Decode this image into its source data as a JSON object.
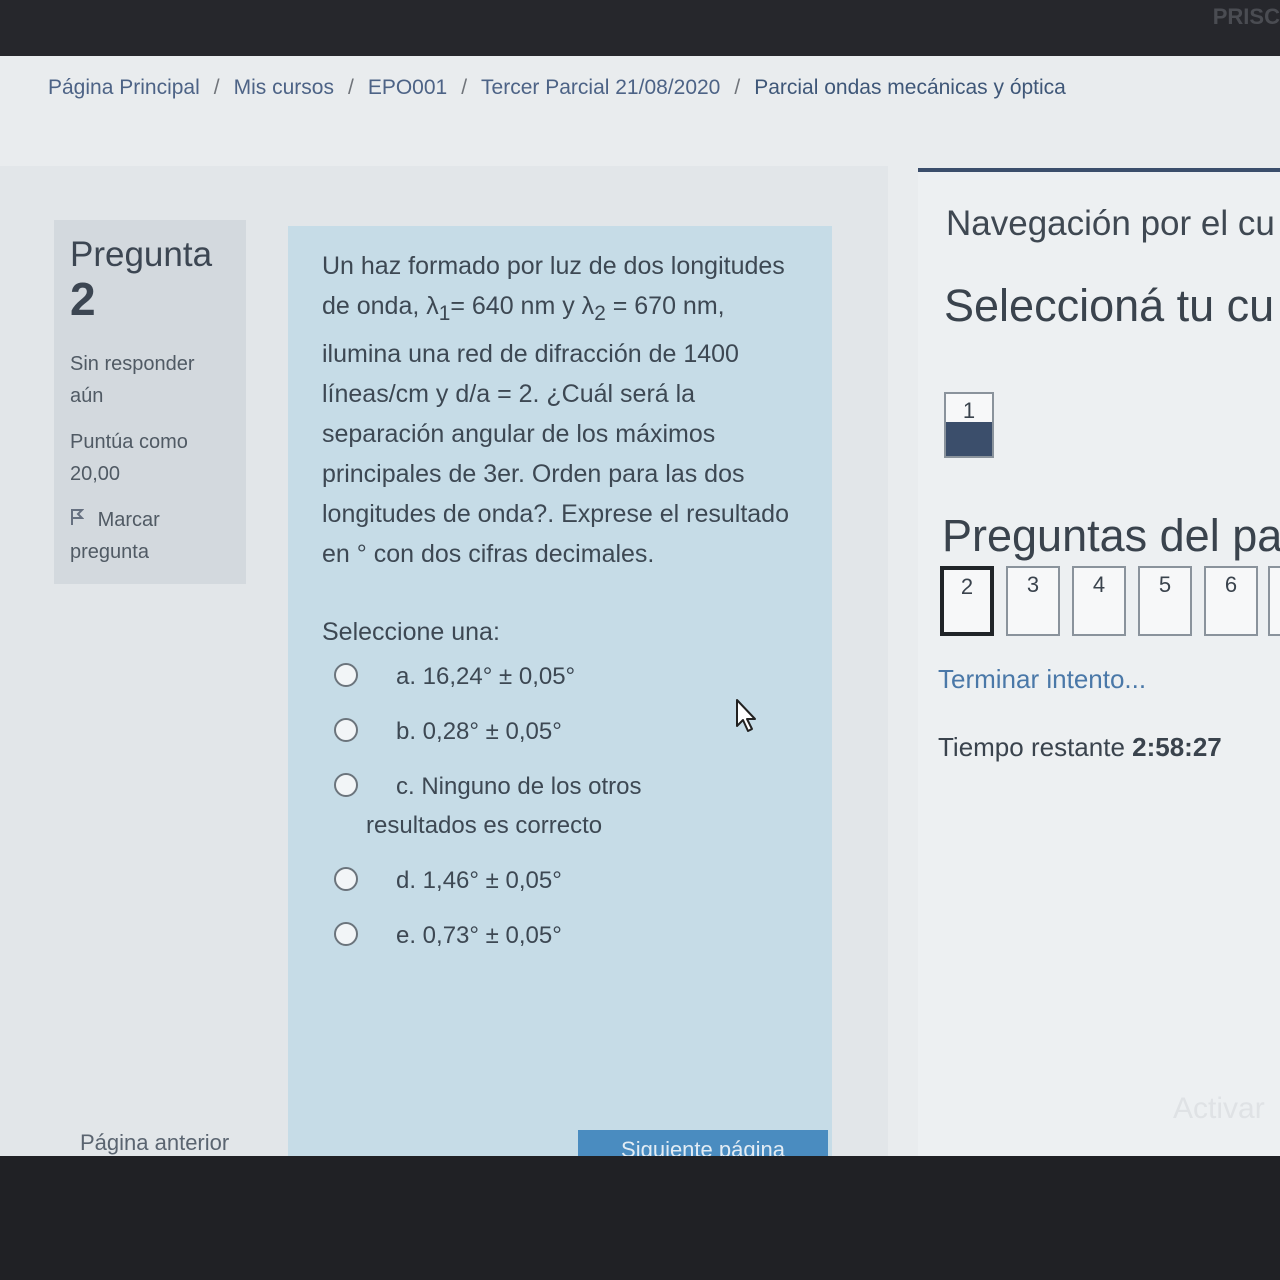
{
  "brand": "PRISC",
  "breadcrumb": [
    {
      "label": "Página Principal"
    },
    {
      "label": "Mis cursos"
    },
    {
      "label": "EPO001"
    },
    {
      "label": "Tercer Parcial 21/08/2020"
    },
    {
      "label": "Parcial ondas mecánicas y óptica"
    }
  ],
  "breadcrumb_separator": "/",
  "question": {
    "word": "Pregunta",
    "number": "2",
    "state_line1": "Sin responder",
    "state_line2": "aún",
    "grade_line1": "Puntúa como",
    "grade_line2": "20,00",
    "flag_line1": "Marcar",
    "flag_line2": "pregunta",
    "text_p1": "Un haz formado por luz de dos longitudes de onda, λ",
    "sub1": "1",
    "text_p2": "= 640 nm y λ",
    "sub2": "2",
    "text_p3": " = 670 nm, ilumina una red de difracción de 1400 líneas/cm y d/a = 2. ¿Cuál será la separación angular de los máximos principales de 3er. Orden para las dos longitudes de onda?. Exprese el resultado en ° con dos cifras decimales.",
    "prompt": "Seleccione una:",
    "options": [
      {
        "text": "a. 16,24° ± 0,05°"
      },
      {
        "text": "b. 0,28° ± 0,05°"
      },
      {
        "line1": "c. Ninguno de los otros",
        "line2": "resultados es correcto"
      },
      {
        "text": "d. 1,46° ± 0,05°"
      },
      {
        "text": "e. 0,73° ± 0,05°"
      }
    ]
  },
  "pager": {
    "prev": "Página anterior",
    "next": "Siguiente página"
  },
  "drawer": {
    "nav_title": "Navegación por el cu",
    "select_title": "Seleccioná tu cu",
    "select_buttons": [
      {
        "label": "1",
        "state": "answered"
      }
    ],
    "pages_title": "Preguntas del pa",
    "page_buttons": [
      {
        "label": "2",
        "state": "current"
      },
      {
        "label": "3"
      },
      {
        "label": "4"
      },
      {
        "label": "5"
      },
      {
        "label": "6"
      }
    ],
    "finish": "Terminar intento...",
    "timer_label": "Tiempo restante",
    "timer_value": "2:58:27",
    "watermark": "Activar"
  },
  "colors": {
    "accent": "#3b4e6b",
    "question_bg": "#c6dce7",
    "link": "#4a78a8"
  },
  "icons": [
    "flag-icon",
    "radio-icon",
    "mouse-pointer-icon"
  ]
}
